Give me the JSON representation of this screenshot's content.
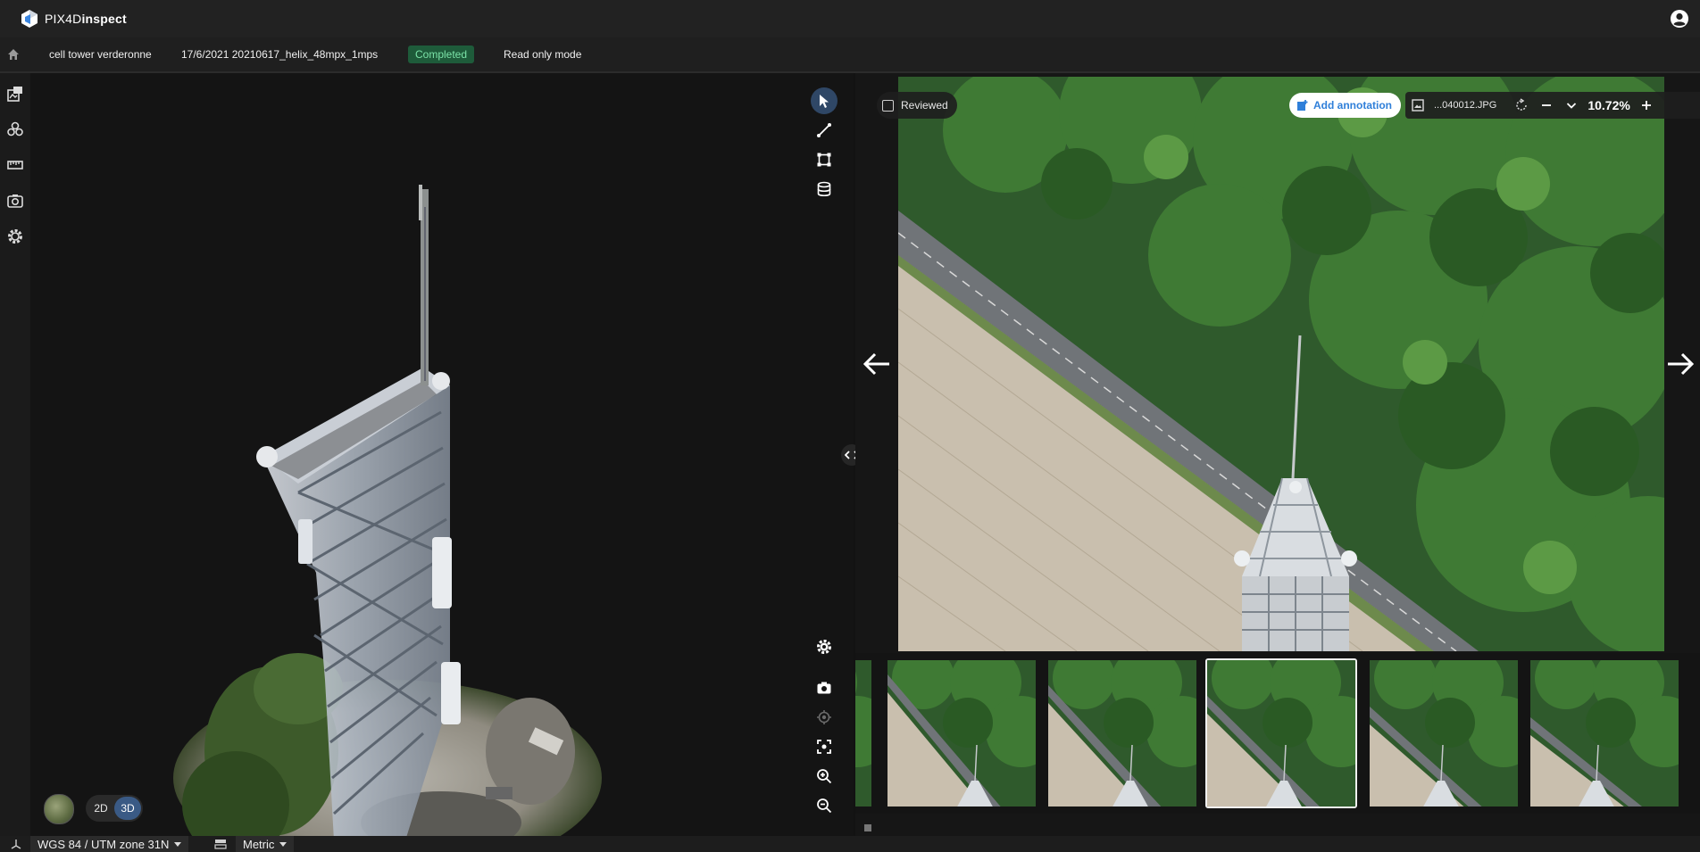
{
  "app": {
    "logo_prefix": "PIX4D",
    "logo_suffix": "inspect"
  },
  "breadcrumb": {
    "project": "cell tower verderonne",
    "dataset": "17/6/2021 20210617_helix_48mpx_1mps",
    "status": "Completed",
    "mode": "Read only mode"
  },
  "colors": {
    "accent": "#2f7fd9",
    "status_bg": "#1e5b3a",
    "status_fg": "#7be3a8",
    "active_tool": "#2f4766"
  },
  "sidebar": {
    "icons": [
      "inspection-reports-icon",
      "layers-icon",
      "measure-ruler-icon",
      "camera-icon",
      "settings-icon"
    ]
  },
  "viewer": {
    "tools": [
      "pointer-icon",
      "polyline-icon",
      "polygon-icon",
      "volume-icon"
    ],
    "bottom_tools": [
      "settings-icon",
      "snapshot-icon",
      "locate-icon",
      "fit-view-icon",
      "zoom-in-icon",
      "zoom-out-icon"
    ],
    "mode_2d": "2D",
    "mode_3d": "3D",
    "active_mode": "3D"
  },
  "image_panel": {
    "reviewed_label": "Reviewed",
    "reviewed_checked": false,
    "add_annotation_label": "Add annotation",
    "filename": "...040012.JPG",
    "zoom": "10.72%",
    "thumbnail_count": 6,
    "selected_thumbnail": 3
  },
  "footer": {
    "crs": "WGS 84 / UTM zone 31N",
    "units": "Metric"
  }
}
